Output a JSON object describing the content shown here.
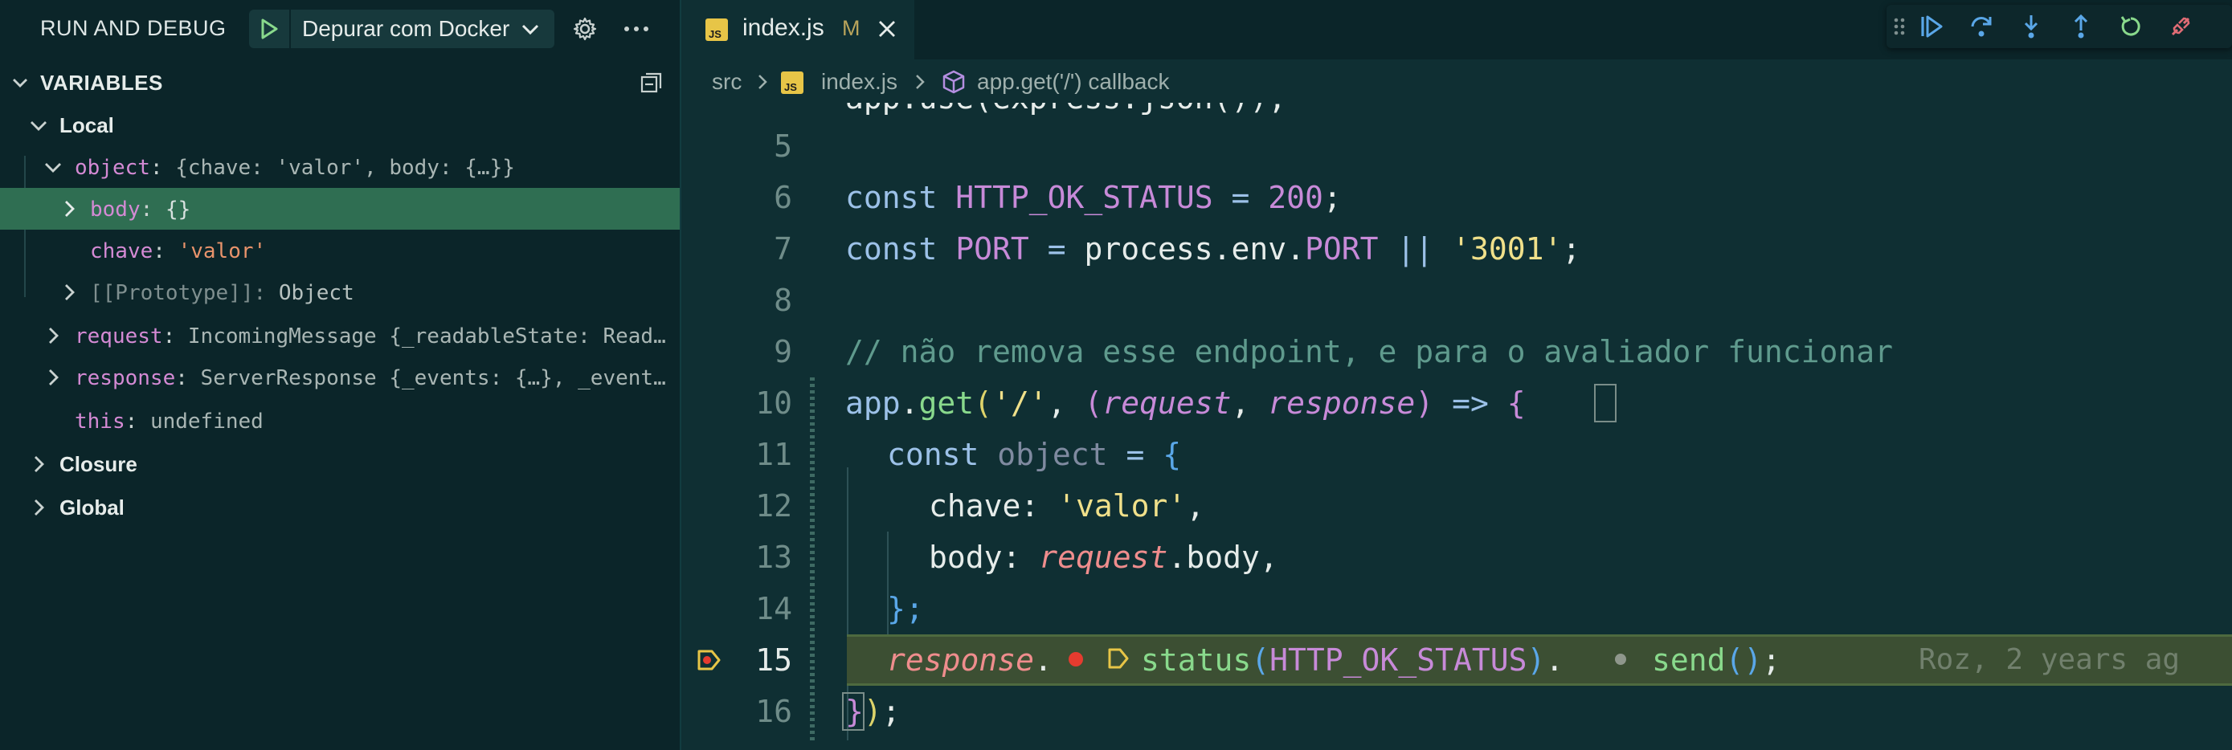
{
  "colors": {
    "accent_green": "#89d98c",
    "selection": "#2f6e52",
    "breakpoint_red": "#e53b2f",
    "current_line": "#3c4f33",
    "debug_arrow": "#e7c547",
    "debug_toolbar_blue": "#5aa7e8",
    "restart_green": "#89d98c",
    "disconnect_red": "#e06c75"
  },
  "debug_panel": {
    "title": "RUN AND DEBUG",
    "config_name": "Depurar com Docker",
    "play_icon": "play-icon",
    "settings_icon": "gear-icon",
    "more_icon": "ellipsis-icon",
    "variables_title": "VARIABLES",
    "collapse_icon": "collapse-all-icon",
    "scopes": {
      "local": "Local",
      "closure": "Closure",
      "global": "Global"
    },
    "variables": {
      "object": {
        "name": "object",
        "value": "{chave: 'valor', body: {…}}"
      },
      "body": {
        "name": "body",
        "value": "{}"
      },
      "chave": {
        "name": "chave",
        "value": "'valor'"
      },
      "prototype": {
        "name": "[[Prototype]]",
        "value": "Object"
      },
      "request": {
        "name": "request",
        "value": "IncomingMessage {_readableState: Read…"
      },
      "response": {
        "name": "response",
        "value": "ServerResponse {_events: {…}, _event…"
      },
      "this": {
        "name": "this",
        "value": "undefined"
      }
    }
  },
  "editor": {
    "tab": {
      "filename": "index.js",
      "status": "M",
      "icon": "js-file-icon",
      "close_icon": "close-icon"
    },
    "breadcrumb": {
      "folder": "src",
      "file": "index.js",
      "symbol": "app.get('/') callback"
    },
    "debug_toolbar": [
      "drag-handle-icon",
      "continue-icon",
      "step-over-icon",
      "step-into-icon",
      "step-out-icon",
      "restart-icon",
      "disconnect-icon"
    ],
    "line_numbers": [
      "5",
      "6",
      "7",
      "8",
      "9",
      "10",
      "11",
      "12",
      "13",
      "14",
      "15",
      "16"
    ],
    "current_line": "15",
    "blame": "Roz, 2 years ag",
    "code": {
      "l6": {
        "kw": "const",
        "name": "HTTP_OK_STATUS",
        "op": "=",
        "num": "200",
        "end": ";"
      },
      "l7": {
        "kw": "const",
        "name": "PORT",
        "op": "=",
        "obj": "process.env.",
        "prop": "PORT",
        "or": "||",
        "str": "'3001'",
        "end": ";"
      },
      "l9": {
        "comment": "// não remova esse endpoint, e para o avaliador funcionar"
      },
      "l10": {
        "obj": "app",
        "fn": "get",
        "route": "'/'",
        "p1": "request",
        "p2": "response",
        "arrow": "=>"
      },
      "l11": {
        "kw": "const",
        "name": "object",
        "op": "="
      },
      "l12": {
        "key": "chave:",
        "str": "'valor'",
        "end": ","
      },
      "l13": {
        "key": "body:",
        "obj": "request",
        "prop": ".body",
        "end": ","
      },
      "l14": {
        "text": "};"
      },
      "l15": {
        "obj": "response",
        "fn1": "status",
        "arg": "HTTP_OK_STATUS",
        "fn2": "send",
        "end": ";"
      },
      "l16": {
        "text": ");"
      }
    }
  }
}
